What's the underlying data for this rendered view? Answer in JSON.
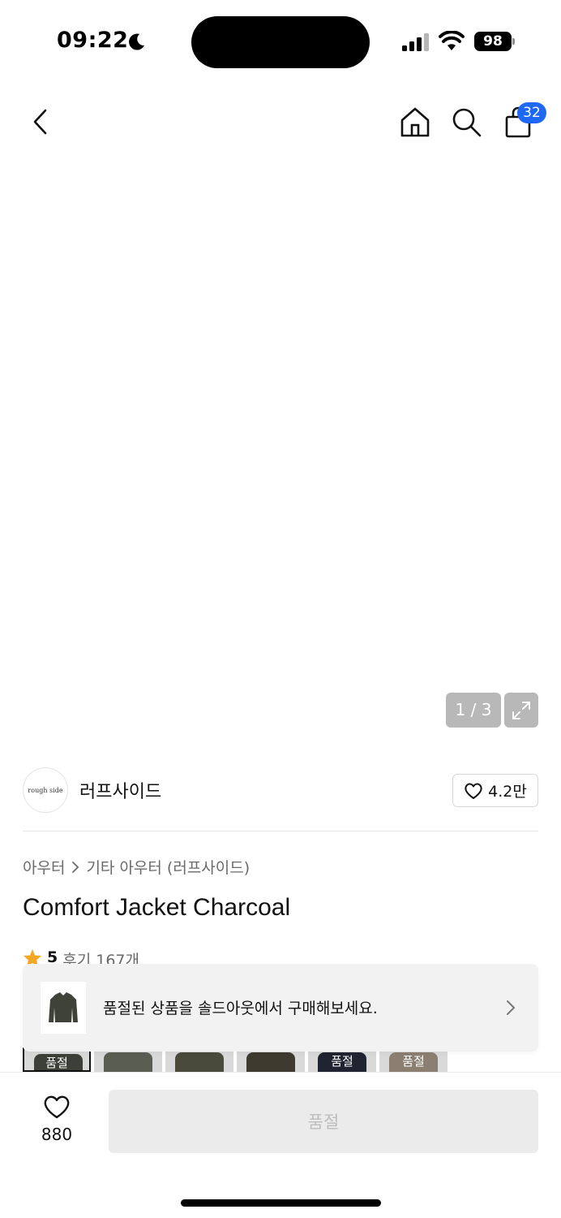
{
  "status_bar": {
    "time": "09:22",
    "battery": "98"
  },
  "header": {
    "cart_count": "32"
  },
  "gallery": {
    "pager": "1 / 3",
    "label_text": "rough side"
  },
  "brand": {
    "logo_text": "rough side",
    "name": "러프사이드",
    "likes": "4.2만"
  },
  "breadcrumb": {
    "category": "아우터",
    "subcategory": "기타 아우터 (러프사이드)"
  },
  "product": {
    "title": "Comfort Jacket Charcoal",
    "score": "5",
    "reviews": "후기 167개"
  },
  "thumbnails": [
    {
      "soldout": "품절",
      "color": "#3d4038"
    },
    {
      "soldout": "",
      "color": "#5a5d52"
    },
    {
      "soldout": "",
      "color": "#4a4a3c"
    },
    {
      "soldout": "",
      "color": "#3f3a30"
    },
    {
      "soldout": "품절",
      "color": "#1f2430"
    },
    {
      "soldout": "품절",
      "color": "#8a7f70"
    }
  ],
  "toast": {
    "message": "품절된 상품을 솔드아웃에서 구매해보세요."
  },
  "bottom": {
    "wish_count": "880",
    "buy_label": "품절"
  },
  "colors": {
    "accent": "#1f67f5",
    "jacket": "#3e4238"
  }
}
